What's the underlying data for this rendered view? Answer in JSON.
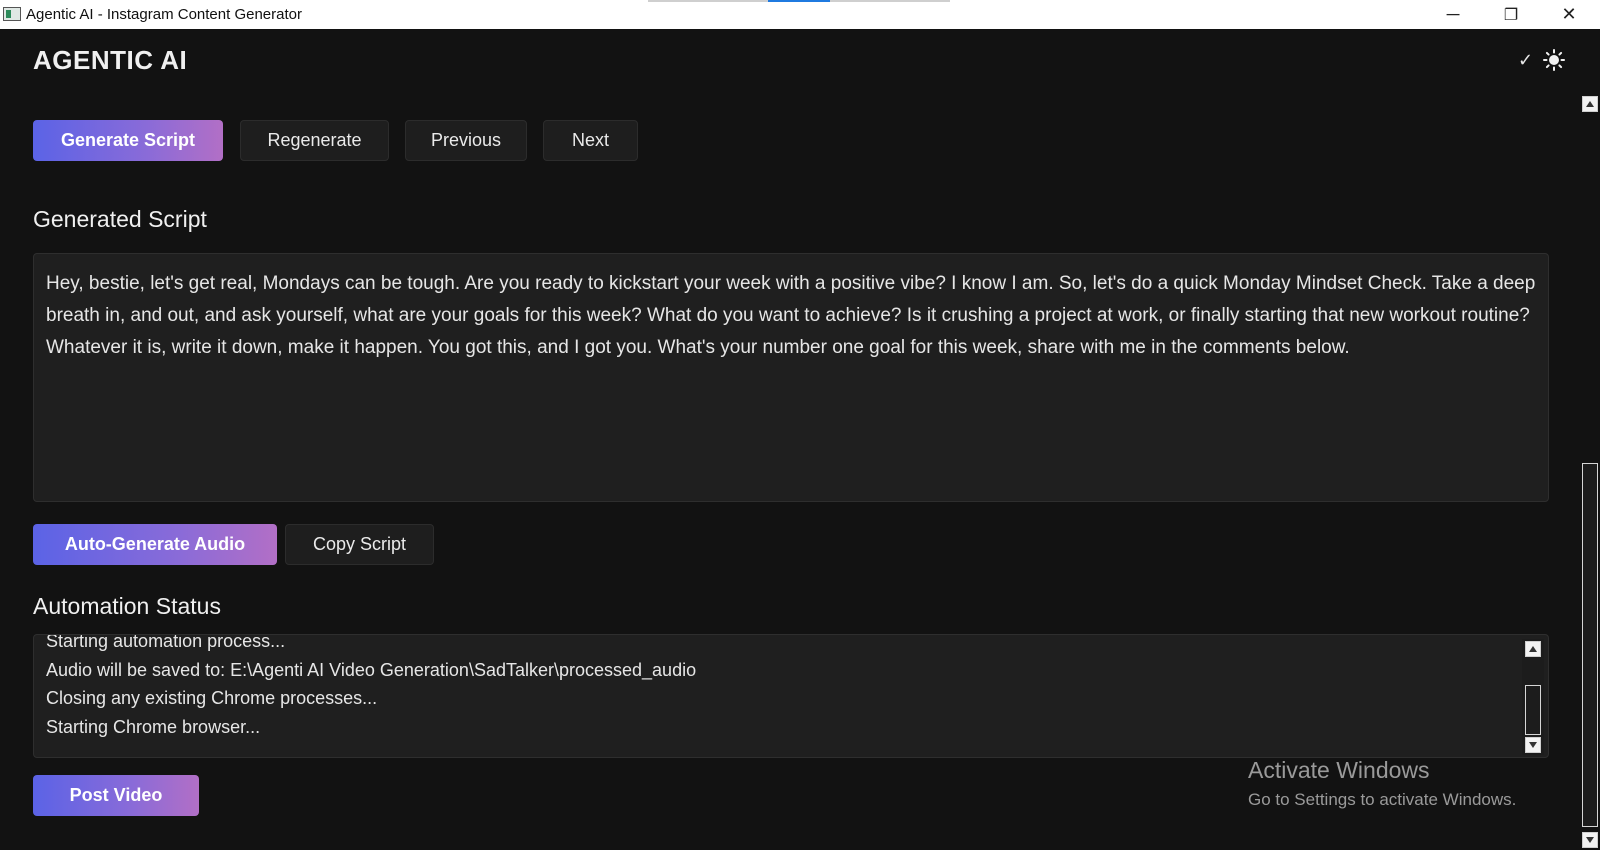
{
  "window": {
    "title": "Agentic AI - Instagram Content Generator",
    "controls": {
      "minimize": "─",
      "restore": "❐",
      "close": "✕"
    }
  },
  "header": {
    "brand": "AGENTIC AI",
    "theme_check": "✓",
    "theme_icon": "sun-icon"
  },
  "toolbar": {
    "generate_label": "Generate Script",
    "regenerate_label": "Regenerate",
    "previous_label": "Previous",
    "next_label": "Next"
  },
  "script_section": {
    "title": "Generated Script",
    "text": "Hey, bestie, let's get real, Mondays can be tough. Are you ready to kickstart your week with a positive vibe? I know I am. So, let's do a quick Monday Mindset Check. Take a deep breath in, and out, and ask yourself, what are your goals for this week? What do you want to achieve? Is it crushing a project at work, or finally starting that new workout routine? Whatever it is, write it down, make it happen. You got this, and I got you. What's your number one goal for this week, share with me in the comments below."
  },
  "script_actions": {
    "auto_audio_label": "Auto-Generate Audio",
    "copy_label": "Copy Script"
  },
  "status_section": {
    "title": "Automation Status",
    "lines": [
      "Starting automation process...",
      "Audio will be saved to: E:\\Agenti AI Video Generation\\SadTalker\\processed_audio",
      "Closing any existing Chrome processes...",
      "Starting Chrome browser..."
    ]
  },
  "post": {
    "label": "Post Video"
  },
  "watermark": {
    "line1": "Activate Windows",
    "line2": "Go to Settings to activate Windows."
  },
  "colors": {
    "background": "#121212",
    "panel": "#1f1f1f",
    "accent_start": "#5b63e6",
    "accent_end": "#b26fc6"
  }
}
